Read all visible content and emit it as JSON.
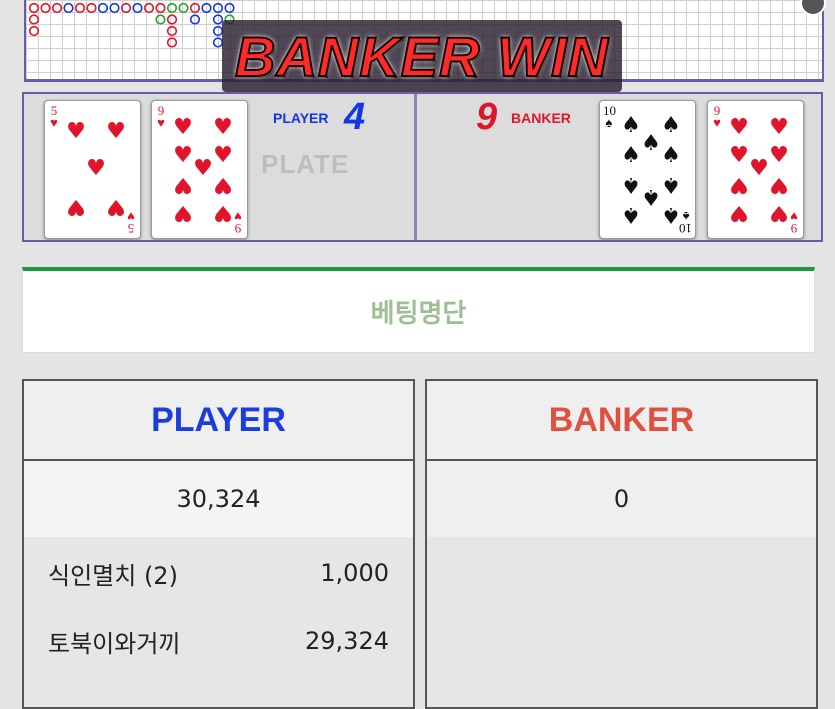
{
  "game": {
    "banner_text": "BANKER WIN",
    "watermark": "PLATE",
    "player": {
      "label": "PLAYER",
      "score": "4",
      "cards": [
        {
          "rank": "5",
          "suit": "hearts"
        },
        {
          "rank": "9",
          "suit": "hearts"
        }
      ]
    },
    "banker": {
      "label": "BANKER",
      "score": "9",
      "cards": [
        {
          "rank": "10",
          "suit": "spades"
        },
        {
          "rank": "9",
          "suit": "hearts"
        }
      ]
    },
    "colors": {
      "player": "#1436e6",
      "banker": "#e0142a",
      "frame": "#6a5ca8"
    }
  },
  "betting_list": {
    "title": "베팅명단",
    "accent": "#1a9a3c"
  },
  "panels": {
    "player": {
      "title": "PLAYER",
      "title_color": "#1b3de0",
      "total": "30,324",
      "bets": [
        {
          "name": "식인멸치 (2)",
          "amount": "1,000"
        },
        {
          "name": "토북이와거끼",
          "amount": "29,324"
        }
      ]
    },
    "banker": {
      "title": "BANKER",
      "title_color": "#e0503f",
      "total": "0",
      "bets": []
    }
  }
}
